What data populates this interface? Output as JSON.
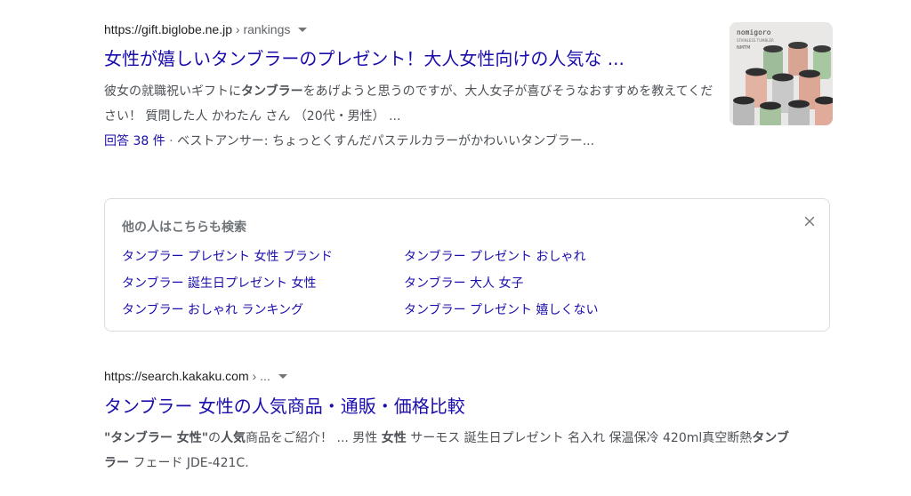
{
  "result1": {
    "url": "https://gift.biglobe.ne.jp",
    "breadcrumb": "› rankings",
    "title": "女性が嬉しいタンブラーのプレゼント！大人女性向けの人気な ...",
    "snippet": [
      {
        "text": "彼女の就職祝いギフトに",
        "bold": false
      },
      {
        "text": "タンブラー",
        "bold": true
      },
      {
        "text": "をあげようと思うのですが、大人女子が喜びそうなおすすめを教えてください！ 質問した人 かわたん さん （20代・男性） ...",
        "bold": false
      }
    ],
    "answer_link": "回答 38 件",
    "answer_sep": "·",
    "answer_rest": "ベストアンサー: ちょっとくすんだパステルカラーがかわいいタンブラー...",
    "thumbnail": {
      "brand": "nomigoro",
      "sub": "STAINLESS TUMBLER",
      "code": "NMTM"
    }
  },
  "related": {
    "title": "他の人はこちらも検索",
    "close_icon": "close-icon",
    "items": [
      "タンブラー プレゼント 女性 ブランド",
      "タンブラー プレゼント おしゃれ",
      "タンブラー 誕生日プレゼント 女性",
      "タンブラー 大人 女子",
      "タンブラー おしゃれ ランキング",
      "タンブラー プレゼント 嬉しくない"
    ]
  },
  "result2": {
    "url": "https://search.kakaku.com",
    "breadcrumb": "› ...",
    "title": "タンブラー 女性の人気商品・通販・価格比較",
    "snippet": [
      {
        "text": "\"タンブラー 女性\"",
        "bold": true
      },
      {
        "text": "の",
        "bold": false
      },
      {
        "text": "人気",
        "bold": true
      },
      {
        "text": "商品をご紹介！ ... 男性 ",
        "bold": false
      },
      {
        "text": "女性",
        "bold": true
      },
      {
        "text": " サーモス 誕生日プレゼント 名入れ 保温保冷 420ml真空断熱",
        "bold": false
      },
      {
        "text": "タンブラー",
        "bold": true
      },
      {
        "text": " フェード JDE-421C.",
        "bold": false
      }
    ]
  },
  "colors": {
    "link": "#1a0dab",
    "text": "#4d5156",
    "muted": "#70757a",
    "border": "#dadce0"
  }
}
